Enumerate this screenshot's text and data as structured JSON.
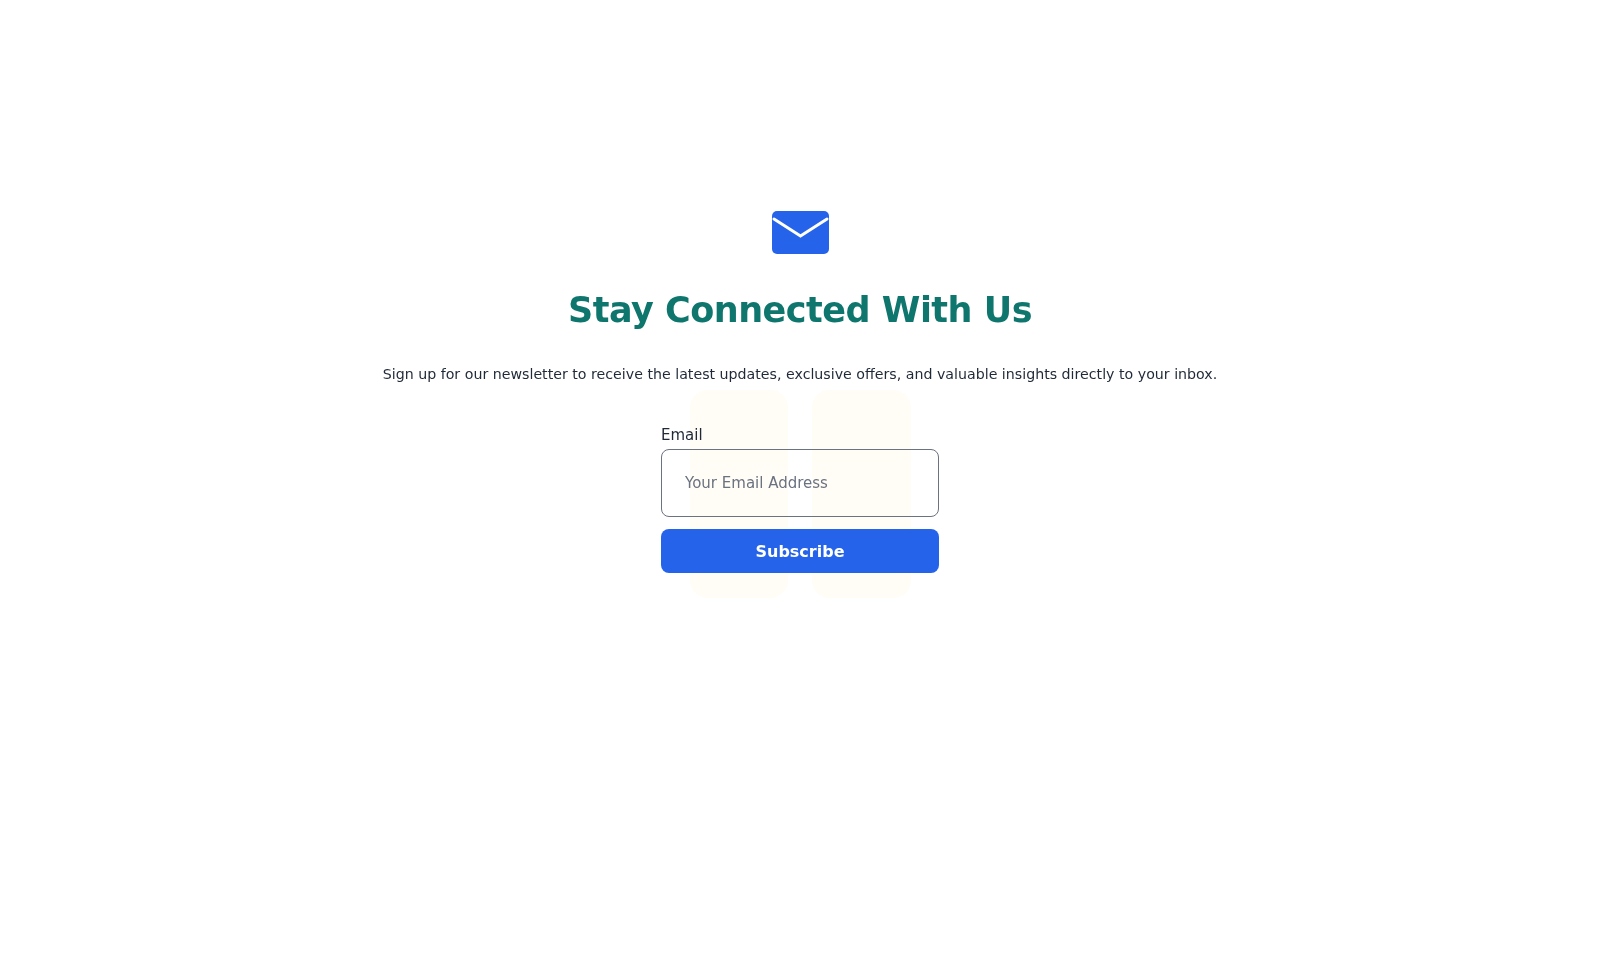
{
  "title": "Stay Connected With Us",
  "description": "Sign up for our newsletter to receive the latest updates, exclusive offers, and valuable insights directly to your inbox.",
  "form": {
    "label": "Email",
    "placeholder": "Your Email Address",
    "button": "Subscribe"
  }
}
